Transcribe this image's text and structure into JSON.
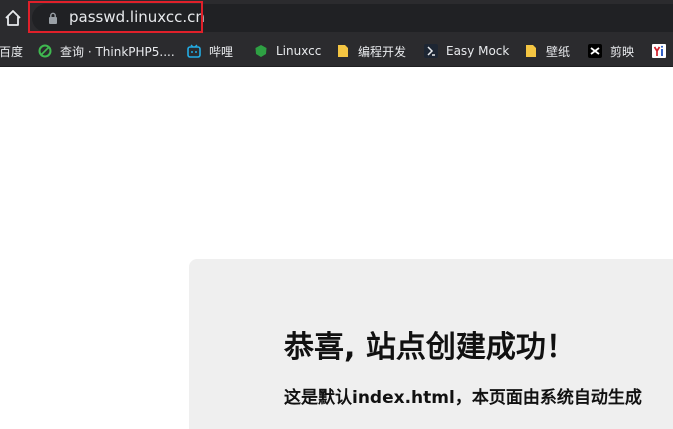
{
  "browser": {
    "address_bar": {
      "url": "passwd.linuxcc.cn"
    },
    "bookmarks": [
      {
        "label": "百度",
        "icon": "none"
      },
      {
        "label": "查询 · ThinkPHP5....",
        "icon": "green-leaf-icon"
      },
      {
        "label": "哔哩",
        "icon": "bilibili-tv-icon"
      },
      {
        "label": "Linuxcc",
        "icon": "green-shield-icon"
      },
      {
        "label": "编程开发",
        "icon": "yellow-folder-icon"
      },
      {
        "label": "Easy Mock",
        "icon": "easy-mock-icon"
      },
      {
        "label": "壁纸",
        "icon": "yellow-folder-icon"
      },
      {
        "label": "剪映",
        "icon": "capcut-icon"
      },
      {
        "label": "",
        "icon": "yi-icon"
      }
    ]
  },
  "page": {
    "title": "恭喜, 站点创建成功！",
    "subtitle": "这是默认index.html，本页面由系统自动生成"
  },
  "colors": {
    "toolbar_bg": "#2b2b2e",
    "omnibox_bg": "#202124",
    "highlight": "#e0202a",
    "card_bg": "#efefef"
  }
}
